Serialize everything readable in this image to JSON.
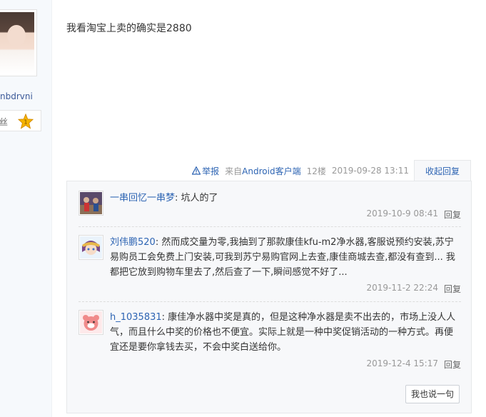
{
  "author": {
    "name": "nbdrvni",
    "fans_label": "丝"
  },
  "post": {
    "text": "我看淘宝上卖的确实是2880"
  },
  "tail": {
    "report_label": "举报",
    "source_prefix": "来自",
    "source_link": "Android客户端",
    "floor": "12楼",
    "time": "2019-09-28 13:11",
    "collapse_label": "收起回复"
  },
  "comments": [
    {
      "user": "一串回忆一串梦",
      "text": ": 坑人的了",
      "time": "2019-10-9 08:41",
      "reply_label": "回复"
    },
    {
      "user": "刘伟鹏520",
      "text": ": 然而成交量为零,我抽到了那款康佳kfu-m2净水器,客服说预约安装,苏宁易购员工会免费上门安装,可我到苏宁易购官网上去查,康佳商城去查,都没有查到... 我都把它放到购物车里去了,然后查了一下,瞬间感觉不好了...",
      "time": "2019-11-2 22:24",
      "reply_label": "回复"
    },
    {
      "user": "h_1035831",
      "text": ": 康佳净水器中奖是真的，但是这种净水器是卖不出去的，市场上没人人气，而且什么中奖的价格也不便宜。实际上就是一种中奖促销活动的一种方式。再便宜还是要你拿钱去买，不会中奖白送给你。",
      "time": "2019-12-4 15:17",
      "reply_label": "回复"
    }
  ],
  "say_button": "我也说一句",
  "colors": {
    "link": "#2d64b3",
    "meta": "#999999",
    "panel_bg": "#f7f8fa"
  },
  "icons": [
    "warning-triangle-icon",
    "star-badge-icon"
  ]
}
